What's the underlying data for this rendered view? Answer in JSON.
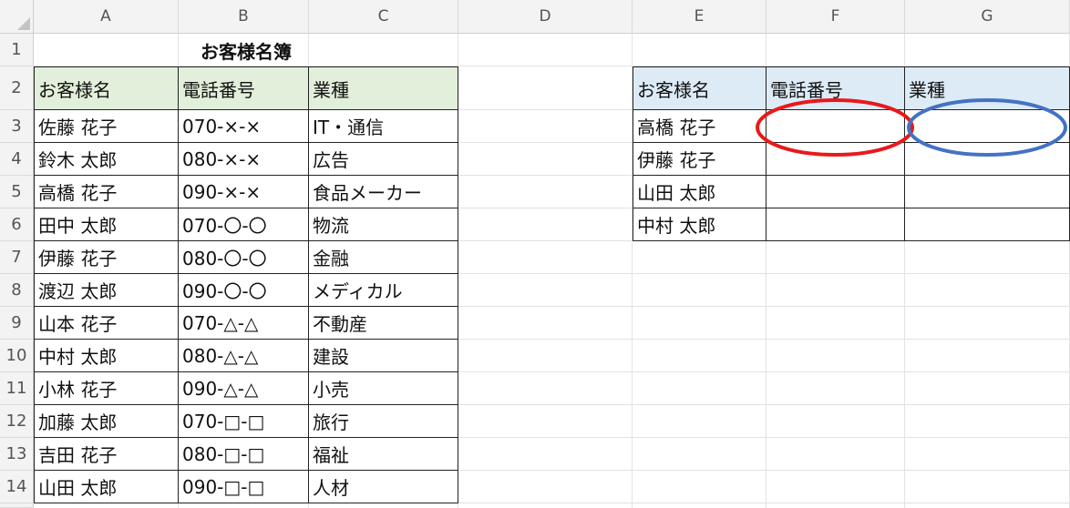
{
  "columns": [
    "A",
    "B",
    "C",
    "D",
    "E",
    "F",
    "G"
  ],
  "rows": [
    "1",
    "2",
    "3",
    "4",
    "5",
    "6",
    "7",
    "8",
    "9",
    "10",
    "11",
    "12",
    "13",
    "14"
  ],
  "title": "お客様名簿",
  "left_table": {
    "headers": [
      "お客様名",
      "電話番号",
      "業種"
    ],
    "rows": [
      [
        "佐藤 花子",
        "070-×-×",
        "IT・通信"
      ],
      [
        "鈴木 太郎",
        "080-×-×",
        "広告"
      ],
      [
        "高橋 花子",
        "090-×-×",
        "食品メーカー"
      ],
      [
        "田中 太郎",
        "070-〇-〇",
        "物流"
      ],
      [
        "伊藤 花子",
        "080-〇-〇",
        "金融"
      ],
      [
        "渡辺 太郎",
        "090-〇-〇",
        "メディカル"
      ],
      [
        "山本 花子",
        "070-△-△",
        "不動産"
      ],
      [
        "中村 太郎",
        "080-△-△",
        "建設"
      ],
      [
        "小林 花子",
        "090-△-△",
        "小売"
      ],
      [
        "加藤 太郎",
        "070-□-□",
        "旅行"
      ],
      [
        "吉田 花子",
        "080-□-□",
        "福祉"
      ],
      [
        "山田 太郎",
        "090-□-□",
        "人材"
      ]
    ]
  },
  "right_table": {
    "headers": [
      "お客様名",
      "電話番号",
      "業種"
    ],
    "names": [
      "高橋 花子",
      "伊藤 花子",
      "山田 太郎",
      "中村 太郎"
    ]
  },
  "annotations": {
    "red_color": "#e8191b",
    "blue_color": "#4472c4"
  },
  "colors": {
    "header_green": "#e2efda",
    "header_blue": "#ddebf7"
  }
}
